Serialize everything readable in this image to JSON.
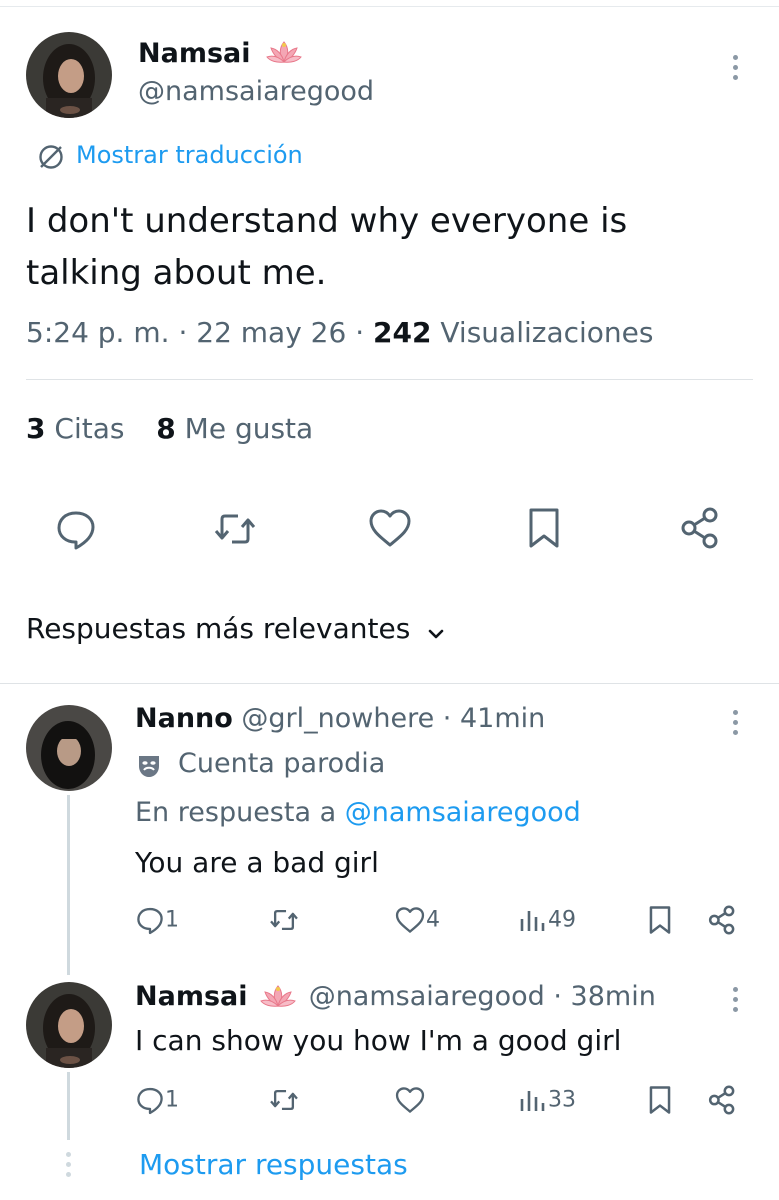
{
  "tweet": {
    "author_name": "Namsai",
    "author_handle": "@namsaiaregood",
    "translate_label": "Mostrar traducción",
    "text_line1": "I don't understand why everyone is",
    "text_line2": "talking about me.",
    "time": "5:24 p. m.",
    "sep1": "·",
    "date": "22 may 26",
    "sep2": "·",
    "views_count": "242",
    "views_label": "Visualizaciones",
    "quotes_count": "3",
    "quotes_label": "Citas",
    "likes_count": "8",
    "likes_label": "Me gusta"
  },
  "actions": {
    "icons": [
      "reply-icon",
      "retweet-icon",
      "like-icon",
      "bookmark-icon",
      "share-icon"
    ]
  },
  "replies_header": {
    "label": "Respuestas más relevantes"
  },
  "replies": [
    {
      "author_name": "Nanno",
      "author_handle": "@grl_nowhere",
      "sep": "·",
      "time": "41min",
      "badge_label": "Cuenta parodia",
      "in_reply_prefix": "En respuesta a",
      "in_reply_handle": "@namsaiaregood",
      "text": "You are a bad girl",
      "reply_count": "1",
      "like_count": "4",
      "view_count": "49"
    },
    {
      "author_name": "Namsai",
      "author_handle": "@namsaiaregood",
      "sep": "·",
      "time": "38min",
      "text": "I can show you how I'm a good girl",
      "reply_count": "1",
      "view_count": "33"
    }
  ],
  "show_replies": {
    "label": "Mostrar respuestas"
  },
  "colors": {
    "accent": "#1d9bf0",
    "text": "#0f1419",
    "muted": "#536471",
    "lotus": "#e8788a"
  }
}
